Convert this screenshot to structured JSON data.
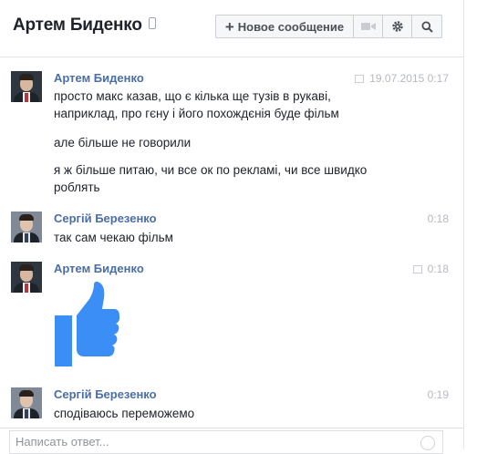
{
  "header": {
    "title": "Артем Биденко",
    "title_icon": "mobile-phone-icon",
    "new_message_label": "Новое сообщение",
    "buttons": [
      "plus-icon",
      "video-call-icon",
      "gear-icon",
      "search-icon"
    ]
  },
  "messages": [
    {
      "author": "Артем Биденко",
      "time": "19.07.2015 0:17",
      "lines": [
        "просто макс казав, що є кілька ще тузів в рукаві,",
        "наприклад, про гєну і його похождєнія буде фільм",
        "але більше не говорили",
        "я ж більше питаю, чи все ок по рекламі, чи все швидко",
        "роблять"
      ]
    },
    {
      "author": "Сергій Березенко",
      "time": "0:18",
      "lines": [
        "так сам чекаю фільм"
      ]
    },
    {
      "author": "Артем Биденко",
      "time": "0:18",
      "sticker": "thumbs-up-icon"
    },
    {
      "author": "Сергій Березенко",
      "time": "0:19",
      "lines": [
        "сподіваюсь переможемо"
      ]
    }
  ],
  "composer": {
    "placeholder": "Написать ответ...",
    "emoji_icon": "smiley-icon"
  },
  "colors": {
    "author_name": "#4b6ea6",
    "thumb": "#3a8ef5",
    "text": "#1d2129",
    "meta": "#b5b9c1"
  }
}
